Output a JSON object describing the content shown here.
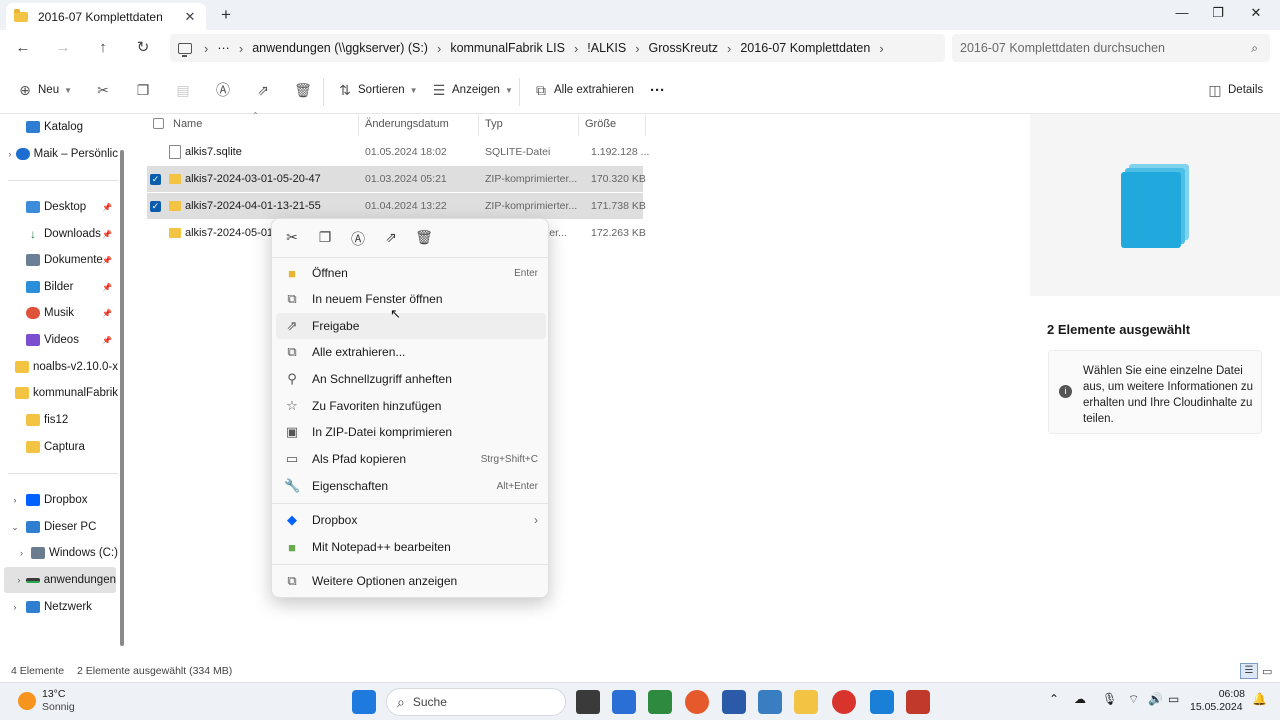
{
  "window": {
    "tab_title": "2016-07 Komplettdaten",
    "new_tab": "+",
    "close_tab": "✕",
    "minimize": "—",
    "maximize": "❐",
    "close": "✕"
  },
  "address": {
    "ellipsis": "···",
    "crumbs": [
      "anwendungen (\\\\ggkserver) (S:)",
      "kommunalFabrik LIS",
      "!ALKIS",
      "GrossKreutz",
      "2016-07 Komplettdaten"
    ],
    "search_placeholder": "2016-07 Komplettdaten durchsuchen"
  },
  "toolbar": {
    "new": "Neu",
    "sort": "Sortieren",
    "view": "Anzeigen",
    "extract_all": "Alle extrahieren",
    "more": "···",
    "details": "Details"
  },
  "sidebar": {
    "items": [
      {
        "label": "Katalog",
        "icon": "catalog-icon"
      },
      {
        "label": "Maik – Persönlic",
        "icon": "onedrive-icon"
      },
      {
        "label": "Desktop",
        "icon": "desktop-icon"
      },
      {
        "label": "Downloads",
        "icon": "download-icon"
      },
      {
        "label": "Dokumente",
        "icon": "documents-icon"
      },
      {
        "label": "Bilder",
        "icon": "pictures-icon"
      },
      {
        "label": "Musik",
        "icon": "music-icon"
      },
      {
        "label": "Videos",
        "icon": "videos-icon"
      },
      {
        "label": "noalbs-v2.10.0-x",
        "icon": "folder-icon"
      },
      {
        "label": "kommunalFabrik",
        "icon": "folder-icon"
      },
      {
        "label": "fis12",
        "icon": "folder-icon"
      },
      {
        "label": "Captura",
        "icon": "folder-icon"
      },
      {
        "label": "Dropbox",
        "icon": "dropbox-icon"
      },
      {
        "label": "Dieser PC",
        "icon": "pc-icon"
      },
      {
        "label": "Windows (C:)",
        "icon": "drive-icon"
      },
      {
        "label": "anwendungen",
        "icon": "network-drive-icon"
      },
      {
        "label": "Netzwerk",
        "icon": "network-icon"
      }
    ]
  },
  "columns": {
    "name": "Name",
    "date": "Änderungsdatum",
    "type": "Typ",
    "size": "Größe"
  },
  "files": [
    {
      "name": "alkis7.sqlite",
      "date": "01.05.2024 18:02",
      "type": "SQLITE-Datei",
      "size": "1.192.128 ..."
    },
    {
      "name": "alkis7-2024-03-01-05-20-47",
      "date": "01.03.2024 05:21",
      "type": "ZIP-komprimierter...",
      "size": "170.320 KB"
    },
    {
      "name": "alkis7-2024-04-01-13-21-55",
      "date": "01.04.2024 13:22",
      "type": "ZIP-komprimierter...",
      "size": "171.738 KB"
    },
    {
      "name": "alkis7-2024-05-01-17",
      "date": "",
      "type": "erter...",
      "size": "172.263 KB"
    }
  ],
  "context_menu": {
    "items": [
      {
        "label": "Öffnen",
        "shortcut": "Enter",
        "icon": "folder-open-icon"
      },
      {
        "label": "In neuem Fenster öffnen",
        "shortcut": "",
        "icon": "new-window-icon"
      },
      {
        "label": "Freigabe",
        "shortcut": "",
        "icon": "share-icon"
      },
      {
        "label": "Alle extrahieren...",
        "shortcut": "",
        "icon": "extract-icon"
      },
      {
        "label": "An Schnellzugriff anheften",
        "shortcut": "",
        "icon": "pin-icon"
      },
      {
        "label": "Zu Favoriten hinzufügen",
        "shortcut": "",
        "icon": "star-icon"
      },
      {
        "label": "In ZIP-Datei komprimieren",
        "shortcut": "",
        "icon": "zip-icon"
      },
      {
        "label": "Als Pfad kopieren",
        "shortcut": "Strg+Shift+C",
        "icon": "path-icon"
      },
      {
        "label": "Eigenschaften",
        "shortcut": "Alt+Enter",
        "icon": "properties-icon"
      },
      {
        "label": "Dropbox",
        "shortcut": "",
        "icon": "dropbox-icon"
      },
      {
        "label": "Mit Notepad++ bearbeiten",
        "shortcut": "",
        "icon": "notepadpp-icon"
      },
      {
        "label": "Weitere Optionen anzeigen",
        "shortcut": "",
        "icon": "more-options-icon"
      }
    ]
  },
  "details": {
    "title": "2 Elemente ausgewählt",
    "info": "Wählen Sie eine einzelne Datei aus, um weitere Informationen zu erhalten und Ihre Cloudinhalte zu teilen."
  },
  "status": {
    "count": "4 Elemente",
    "selection": "2 Elemente ausgewählt (334 MB)"
  },
  "taskbar": {
    "weather_temp": "13°C",
    "weather_text": "Sonnig",
    "search": "Suche",
    "time": "06:08",
    "date": "15.05.2024"
  }
}
